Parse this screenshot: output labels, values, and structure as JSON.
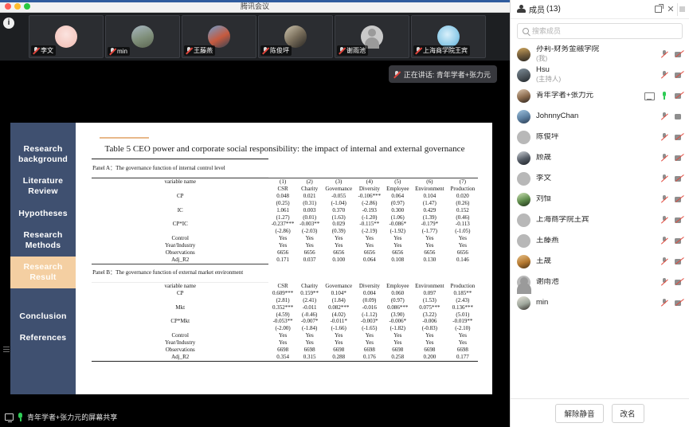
{
  "window": {
    "title": "腾讯会议",
    "traffic_lights": [
      "close",
      "minimize",
      "zoom"
    ]
  },
  "filmstrip": {
    "info_badge": "i",
    "thumbnails": [
      {
        "name": "李文",
        "muted": true,
        "avatar": "av-pink"
      },
      {
        "name": "min",
        "muted": true,
        "avatar": "av-land"
      },
      {
        "name": "王藤燕",
        "muted": true,
        "avatar": "av-car"
      },
      {
        "name": "陈俊坪",
        "muted": true,
        "avatar": "av-rock"
      },
      {
        "name": "谢雨池",
        "muted": true,
        "avatar": "av-gray"
      },
      {
        "name": "上海商学院王宾",
        "muted": true,
        "avatar": "av-blue"
      }
    ]
  },
  "speaking_toast": {
    "text": "正在讲话: 青年学者+张力元"
  },
  "share_bar": {
    "text": "青年学者+张力元的屏幕共享"
  },
  "slide": {
    "nav": [
      {
        "label": "Research background",
        "active": false
      },
      {
        "label": "Literature Review",
        "active": false
      },
      {
        "label": "Hypotheses",
        "active": false
      },
      {
        "label": "Research Methods",
        "active": false
      },
      {
        "label": "Research Result",
        "active": true
      },
      {
        "label": "Conclusion",
        "active": false
      },
      {
        "label": "References",
        "active": false
      }
    ],
    "title": "Table 5   CEO power and corporate social responsibility: the impact of internal and external governance",
    "panelA_head": "Panel A：The governance function of internal control level",
    "panelB_head": "Panel B：The governance function of external market environment",
    "variable_label": "variable name",
    "column_numbers": [
      "(1)",
      "(2)",
      "(3)",
      "(4)",
      "(5)",
      "(6)",
      "(7)"
    ],
    "columns": [
      "CSR",
      "Charity",
      "Governance",
      "Diversity",
      "Employee",
      "Environment",
      "Production"
    ],
    "panelA_rows": [
      {
        "label": "CP",
        "cells": [
          "0.048",
          "0.021",
          "-0.055",
          "-0.106***",
          "0.064",
          "0.104",
          "0.020"
        ]
      },
      {
        "label": "",
        "cells": [
          "(0.25)",
          "(0.31)",
          "(-1.04)",
          "(-2.86)",
          "(0.97)",
          "(1.47)",
          "(0.26)"
        ]
      },
      {
        "label": "IC",
        "cells": [
          "1.061",
          "0.003",
          "0.370",
          "-0.193",
          "0.300",
          "0.429",
          "0.152"
        ]
      },
      {
        "label": "",
        "cells": [
          "(1.27)",
          "(0.01)",
          "(1.63)",
          "(-1.20)",
          "(1.06)",
          "(1.39)",
          "(0.46)"
        ]
      },
      {
        "label": "CP*IC",
        "cells": [
          "-0.237***",
          "-0.003**",
          "0.029",
          "-0.115**",
          "-0.086*",
          "-0.179*",
          "-0.113"
        ]
      },
      {
        "label": "",
        "cells": [
          "(-2.86)",
          "(-2.03)",
          "(0.39)",
          "(-2.19)",
          "(-1.92)",
          "(-1.77)",
          "(-1.05)"
        ]
      },
      {
        "label": "Control",
        "cells": [
          "Yes",
          "Yes",
          "Yes",
          "Yes",
          "Yes",
          "Yes",
          "Yes"
        ]
      },
      {
        "label": "Year/Industry",
        "cells": [
          "Yes",
          "Yes",
          "Yes",
          "Yes",
          "Yes",
          "Yes",
          "Yes"
        ]
      },
      {
        "label": "Observations",
        "cells": [
          "6656",
          "6656",
          "6656",
          "6656",
          "6656",
          "6656",
          "6656"
        ]
      },
      {
        "label": "Adj_R2",
        "cells": [
          "0.171",
          "0.037",
          "0.100",
          "0.064",
          "0.108",
          "0.130",
          "0.146"
        ]
      }
    ],
    "panelB_rows": [
      {
        "label": "CP",
        "cells": [
          "0.609***",
          "0.159**",
          "0.104*",
          "0.004",
          "0.060",
          "0.097",
          "0.185**"
        ]
      },
      {
        "label": "",
        "cells": [
          "(2.81)",
          "(2.41)",
          "(1.84)",
          "(0.09)",
          "(0.97)",
          "(1.53)",
          "(2.43)"
        ]
      },
      {
        "label": "Mkt",
        "cells": [
          "0.352***",
          "-0.011",
          "0.082***",
          "-0.016",
          "0.086***",
          "0.075***",
          "0.136***"
        ]
      },
      {
        "label": "",
        "cells": [
          "(4.59)",
          "(-0.46)",
          "(4.02)",
          "(-1.12)",
          "(3.90)",
          "(3.22)",
          "(5.01)"
        ]
      },
      {
        "label": "CP*Mkt",
        "cells": [
          "-0.053**",
          "-0.007*",
          "-0.011*",
          "-0.003*",
          "-0.006*",
          "-0.006",
          "-0.019**"
        ]
      },
      {
        "label": "",
        "cells": [
          "(-2.00)",
          "(-1.84)",
          "(-1.66)",
          "(-1.65)",
          "(-1.82)",
          "(-0.83)",
          "(-2.10)"
        ]
      },
      {
        "label": "Control",
        "cells": [
          "Yes",
          "Yes",
          "Yes",
          "Yes",
          "Yes",
          "Yes",
          "Yes"
        ]
      },
      {
        "label": "Year/Industry",
        "cells": [
          "Yes",
          "Yes",
          "Yes",
          "Yes",
          "Yes",
          "Yes",
          "Yes"
        ]
      },
      {
        "label": "Observations",
        "cells": [
          "6698",
          "6698",
          "6698",
          "6698",
          "6698",
          "6698",
          "6698"
        ]
      },
      {
        "label": "Adj_R2",
        "cells": [
          "0.354",
          "0.315",
          "0.288",
          "0.176",
          "0.258",
          "0.200",
          "0.177"
        ]
      }
    ]
  },
  "panel": {
    "title": "成员",
    "count": "(13)",
    "search_placeholder": "搜索成员",
    "search_value": "",
    "participants": [
      {
        "name": "孙莉-财务金融学院",
        "sub": "(我)",
        "avatar": "av-sun",
        "mic": "muted",
        "cam": "off",
        "sharing": false
      },
      {
        "name": "Hsu",
        "sub": "(主持人)",
        "avatar": "av-hat",
        "mic": "muted",
        "cam": "off",
        "sharing": false
      },
      {
        "name": "青年学者+张力元",
        "sub": "",
        "avatar": "av-man",
        "mic": "on",
        "cam": "off",
        "sharing": true
      },
      {
        "name": "JohnnyChan",
        "sub": "",
        "avatar": "av-city",
        "mic": "muted",
        "cam": "plain",
        "sharing": false
      },
      {
        "name": "陈俊坪",
        "sub": "",
        "avatar": "av-rock",
        "mic": "muted",
        "cam": "off",
        "sharing": false
      },
      {
        "name": "顾晟",
        "sub": "",
        "avatar": "av-suit",
        "mic": "muted",
        "cam": "off",
        "sharing": false
      },
      {
        "name": "李文",
        "sub": "",
        "avatar": "av-pink",
        "mic": "muted",
        "cam": "off",
        "sharing": false
      },
      {
        "name": "刘恒",
        "sub": "",
        "avatar": "av-leaf",
        "mic": "muted",
        "cam": "off",
        "sharing": false
      },
      {
        "name": "上海商学院王宾",
        "sub": "",
        "avatar": "av-blue",
        "mic": "muted",
        "cam": "off",
        "sharing": false
      },
      {
        "name": "王藤燕",
        "sub": "",
        "avatar": "av-car",
        "mic": "muted",
        "cam": "off",
        "sharing": false
      },
      {
        "name": "王晟",
        "sub": "",
        "avatar": "av-dog",
        "mic": "muted",
        "cam": "off",
        "sharing": false
      },
      {
        "name": "谢雨池",
        "sub": "",
        "avatar": "av-gray",
        "mic": "muted",
        "cam": "off",
        "sharing": false
      },
      {
        "name": "min",
        "sub": "",
        "avatar": "av-sea",
        "mic": "muted",
        "cam": "off",
        "sharing": false
      }
    ],
    "footer": {
      "unmute_label": "解除静音",
      "rename_label": "改名"
    }
  },
  "colors": {
    "slide_nav_bg": "#3f5070",
    "slide_nav_active": "#f4cfa2",
    "accent_rule": "#e8b88a",
    "mic_on": "#2ecc55",
    "mute_slash": "#e2493d"
  }
}
